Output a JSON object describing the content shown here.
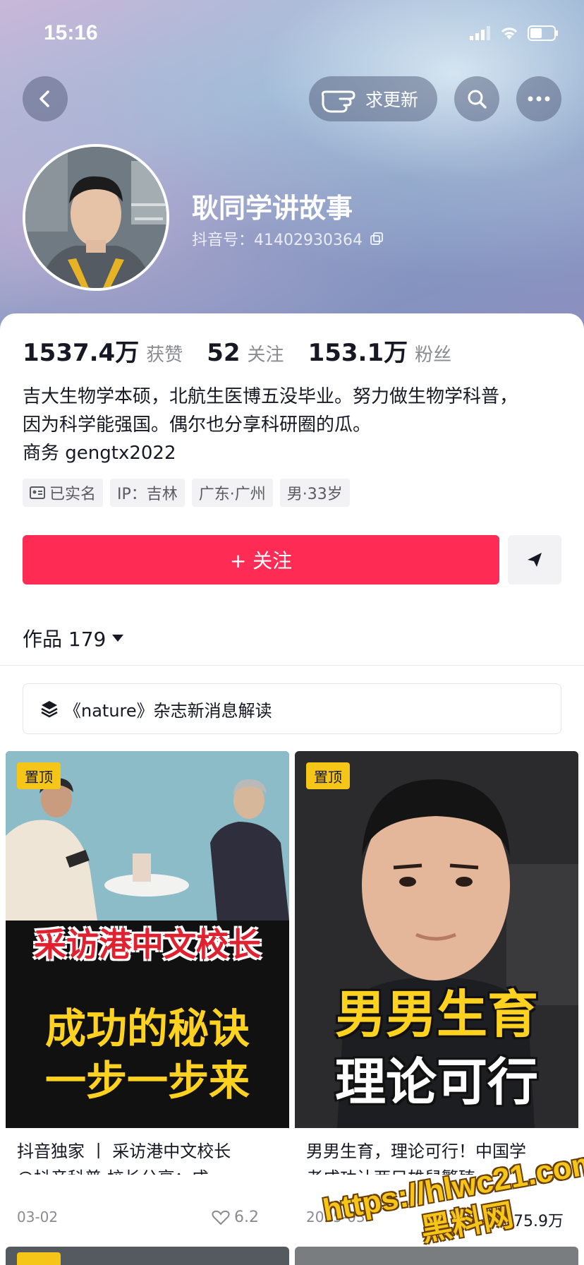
{
  "status_bar": {
    "time": "15:16"
  },
  "header": {
    "request_update_label": "求更新",
    "name": "耿同学讲故事",
    "douyin_id": "抖音号：41402930364"
  },
  "stats": [
    {
      "value": "1537.4万",
      "label": "获赞"
    },
    {
      "value": "52",
      "label": "关注"
    },
    {
      "value": "153.1万",
      "label": "粉丝"
    }
  ],
  "bio": {
    "line1": "吉大生物学本硕，北航生医博五没毕业。努力做生物学科普，",
    "line2": "因为科学能强国。偶尔也分享科研圈的瓜。",
    "line3": "商务 gengtx2022"
  },
  "tags": {
    "verified": "已实名",
    "ip": "IP：吉林",
    "location": "广东·广州",
    "gender_age": "男·33岁"
  },
  "actions": {
    "follow_label": "+ 关注"
  },
  "works": {
    "label": "作品 179"
  },
  "collection": {
    "label": "《nature》杂志新消息解读"
  },
  "videos": [
    {
      "pinned": "置顶",
      "thumb_line1": "采访港中文校长",
      "thumb_line2": "成功的秘诀",
      "thumb_line3": "一步一步来",
      "title_line1": "抖音独家 丨 采访港中文校长",
      "title_line2": "@抖音科普 校长分享：成…",
      "date": "03-02",
      "likes": "6.2"
    },
    {
      "pinned": "置顶",
      "thumb_line1": "男男生育",
      "thumb_line2": "理论可行",
      "title_line1": "男男生育，理论可行！中国学",
      "title_line2": "者成功让两只雄鼠繁殖…",
      "date": "2025-03",
      "likes": "75.9万"
    }
  ],
  "watermark": {
    "line1": "https://hlwc21.com",
    "line2": "黑料网"
  },
  "colors": {
    "accent": "#fe2c55",
    "pin": "#f5c518"
  }
}
